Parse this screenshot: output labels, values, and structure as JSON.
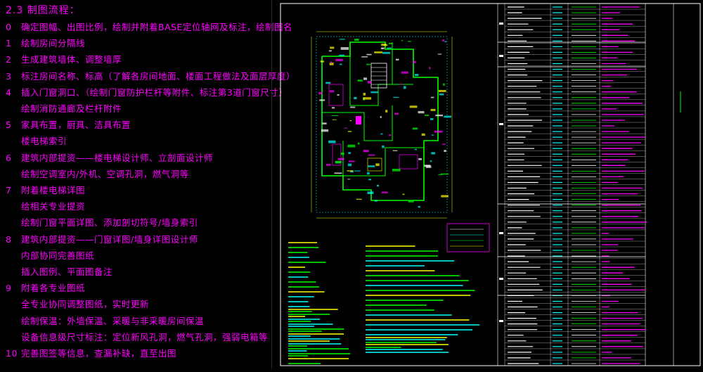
{
  "title": "2.3 制图流程：",
  "steps": [
    {
      "num": "0",
      "text": "确定图幅、出图比例，绘制并附着BASE定位轴网及标注，绘制图名"
    },
    {
      "num": "1",
      "text": "绘制房间分隔线"
    },
    {
      "num": "2",
      "text": "生成建筑墙体、调整墙厚"
    },
    {
      "num": "3",
      "text": "标注房间名称、标高（了解各房间地面、楼面工程做法及面层厚度）"
    },
    {
      "num": "4",
      "text": "插入门窗洞口、（绘制门窗防护栏杆等附件、标注第3道门窗尺寸）"
    },
    {
      "num": "",
      "text": "绘制消防通廊及栏杆附件"
    },
    {
      "num": "5",
      "text": "家具布置，厨具、洁具布置"
    },
    {
      "num": "",
      "text": "楼电梯索引"
    },
    {
      "num": "6",
      "text": "建筑内部提资——楼电梯设计师、立剖面设计师"
    },
    {
      "num": "",
      "text": "绘制空调室内/外机、空调孔洞，燃气洞等"
    },
    {
      "num": "7",
      "text": "附着楼电梯详图"
    },
    {
      "num": "",
      "text": "给相关专业提资"
    },
    {
      "num": "",
      "text": "绘制门窗平面详图、添加剖切符号/墙身索引"
    },
    {
      "num": "8",
      "text": "建筑内部提资——门窗详图/墙身详图设计师"
    },
    {
      "num": "",
      "text": "内部协同完善图纸"
    },
    {
      "num": "",
      "text": "插入图例、平面图备注"
    },
    {
      "num": "9",
      "text": "附着各专业图纸"
    },
    {
      "num": "",
      "text": "全专业协同调整图纸，实时更新"
    },
    {
      "num": "",
      "text": "绘制保温：外墙保温、采暖与非采暖房间保温"
    },
    {
      "num": "",
      "text": "设备信息级尺寸标注：定位新风孔洞，燃气孔洞，强弱电箱等"
    },
    {
      "num": "10",
      "text": "完善图签等信息，查漏补缺，直至出图"
    }
  ],
  "colors": {
    "magenta": "#ff00ff",
    "frame": "#ffffff",
    "wall": "#00ff00",
    "axis": "#00ffff",
    "dim": "#ffff00",
    "accent": "#ff00ff"
  }
}
